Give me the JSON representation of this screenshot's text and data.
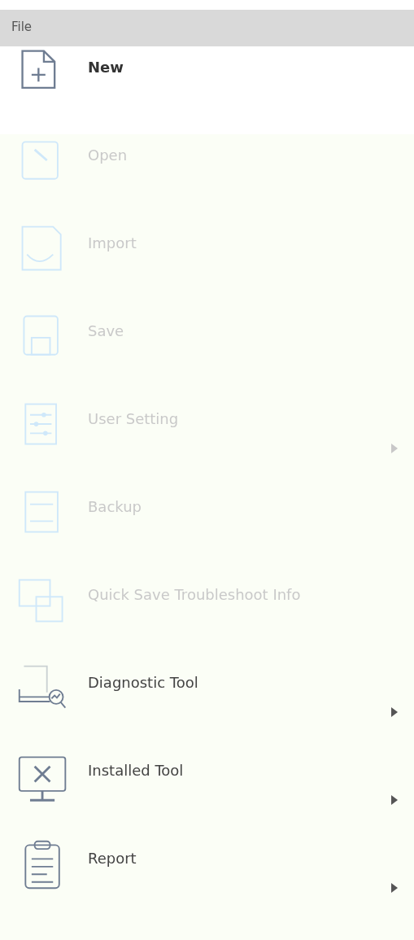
{
  "menu": {
    "title": "File",
    "items": [
      {
        "label": "New",
        "disabled": false,
        "highlighted": true,
        "submenu": false
      },
      {
        "label": "Open",
        "disabled": true,
        "highlighted": false,
        "submenu": false
      },
      {
        "label": "Import",
        "disabled": true,
        "highlighted": false,
        "submenu": false
      },
      {
        "label": "Save",
        "disabled": true,
        "highlighted": false,
        "submenu": false
      },
      {
        "label": "User Setting",
        "disabled": true,
        "highlighted": false,
        "submenu": true
      },
      {
        "label": "Backup",
        "disabled": true,
        "highlighted": false,
        "submenu": false
      },
      {
        "label": "Quick Save Troubleshoot Info",
        "disabled": true,
        "highlighted": false,
        "submenu": false
      },
      {
        "label": "Diagnostic Tool",
        "disabled": false,
        "highlighted": false,
        "submenu": true
      },
      {
        "label": "Installed Tool",
        "disabled": false,
        "highlighted": false,
        "submenu": true
      },
      {
        "label": "Report",
        "disabled": false,
        "highlighted": false,
        "submenu": true
      }
    ]
  }
}
